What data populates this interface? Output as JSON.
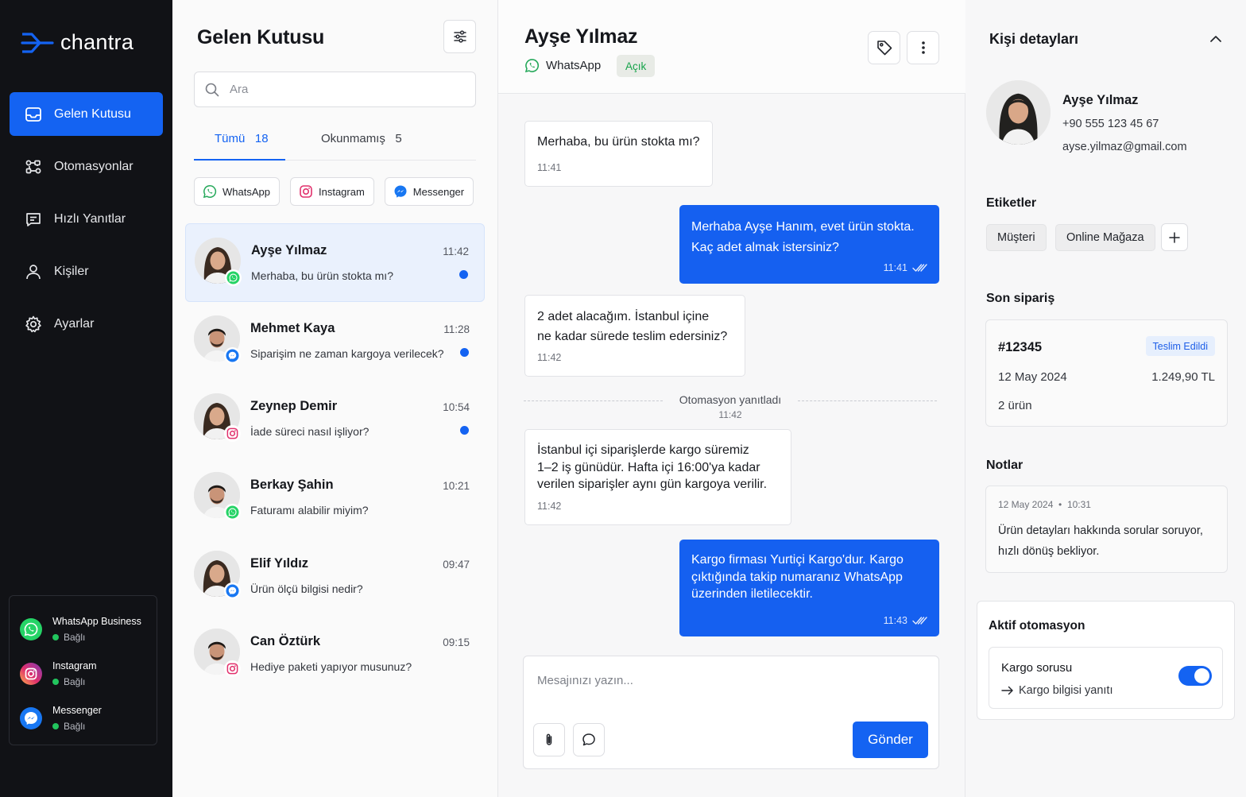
{
  "app": {
    "name": "chantra"
  },
  "colors": {
    "accent": "#1463f2",
    "sidebar_bg": "#111216",
    "online": "#22c55e",
    "open_status": "#16a34a"
  },
  "sidebar": {
    "nav": [
      {
        "label": "Gelen Kutusu",
        "icon": "inbox-icon",
        "active": true
      },
      {
        "label": "Otomasyonlar",
        "icon": "workflow-icon"
      },
      {
        "label": "Hızlı Yanıtlar",
        "icon": "quick-reply-icon"
      },
      {
        "label": "Kişiler",
        "icon": "user-icon"
      },
      {
        "label": "Ayarlar",
        "icon": "gear-icon"
      }
    ],
    "channels": [
      {
        "name": "WhatsApp Business",
        "status": "Bağlı",
        "icon": "whatsapp-icon"
      },
      {
        "name": "Instagram",
        "status": "Bağlı",
        "icon": "instagram-icon"
      },
      {
        "name": "Messenger",
        "status": "Bağlı",
        "icon": "messenger-icon"
      }
    ]
  },
  "inbox": {
    "title": "Gelen Kutusu",
    "search_placeholder": "Ara",
    "tabs": [
      {
        "label": "Tümü",
        "count": "18",
        "active": true
      },
      {
        "label": "Okunmamış",
        "count": "5"
      }
    ],
    "channel_filters": [
      {
        "label": "WhatsApp",
        "icon": "whatsapp-icon"
      },
      {
        "label": "Instagram",
        "icon": "instagram-icon"
      },
      {
        "label": "Messenger",
        "icon": "messenger-icon"
      }
    ],
    "conversations": [
      {
        "name": "Ayşe Yılmaz",
        "time": "11:42",
        "message": "Merhaba, bu ürün stokta mı?",
        "channel": "whatsapp",
        "unread": true,
        "active": true,
        "gender": "f"
      },
      {
        "name": "Mehmet Kaya",
        "time": "11:28",
        "message": "Siparişim ne zaman kargoya verilecek?",
        "channel": "messenger",
        "unread": true,
        "gender": "m"
      },
      {
        "name": "Zeynep Demir",
        "time": "10:54",
        "message": "İade süreci nasıl işliyor?",
        "channel": "instagram",
        "unread": true,
        "gender": "f"
      },
      {
        "name": "Berkay Şahin",
        "time": "10:21",
        "message": "Faturamı alabilir miyim?",
        "channel": "whatsapp",
        "unread": false,
        "gender": "m"
      },
      {
        "name": "Elif Yıldız",
        "time": "09:47",
        "message": "Ürün ölçü bilgisi nedir?",
        "channel": "messenger",
        "unread": false,
        "gender": "f"
      },
      {
        "name": "Can Öztürk",
        "time": "09:15",
        "message": "Hediye paketi yapıyor musunuz?",
        "channel": "instagram",
        "unread": false,
        "gender": "m"
      }
    ]
  },
  "chat": {
    "contact_name": "Ayşe Yılmaz",
    "channel": "WhatsApp",
    "status": "Açık",
    "messages": [
      {
        "text": "Merhaba, bu ürün stokta mı?",
        "time": "11:41",
        "dir": "in"
      },
      {
        "text": "Merhaba Ayşe Hanım, evet ürün stokta.\nKaç adet almak istersiniz?",
        "time": "11:41",
        "dir": "out"
      },
      {
        "text": "2 adet alacağım. İstanbul içine\nne kadar sürede teslim edersiniz?",
        "time": "11:42",
        "dir": "in"
      },
      {
        "text": "İstanbul içi siparişlerde kargo süremiz\n1–2 iş günüdür. Hafta içi 16:00'ya kadar\nverilen siparişler aynı gün kargoya verilir.",
        "time": "11:42",
        "dir": "in"
      },
      {
        "text": "Kargo firması Yurtiçi Kargo'dur. Kargo\nçıktığında takip numaranız WhatsApp\nüzerinden iletilecektir.",
        "time": "11:43",
        "dir": "out"
      }
    ],
    "automation_separator": {
      "label": "Otomasyon yanıtladı",
      "time": "11:42"
    },
    "composer_placeholder": "Mesajınızı yazın...",
    "send_label": "Gönder"
  },
  "details": {
    "title": "Kişi detayları",
    "contact": {
      "name": "Ayşe Yılmaz",
      "phone": "+90 555 123 45 67",
      "email": "ayse.yilmaz@gmail.com"
    },
    "tags_title": "Etiketler",
    "tags": [
      "Müşteri",
      "Online Mağaza"
    ],
    "last_order_title": "Son sipariş",
    "order": {
      "id": "#12345",
      "status": "Teslim Edildi",
      "date": "12 May 2024",
      "amount": "1.249,90 TL",
      "items": "2 ürün"
    },
    "notes_title": "Notlar",
    "note": {
      "date": "12 May 2024",
      "time": "10:31",
      "text": "Ürün detayları hakkında sorular soruyor, hızlı dönüş bekliyor."
    },
    "automation_title": "Aktif otomasyon",
    "automation": {
      "name": "Kargo sorusu",
      "action": "Kargo bilgisi yanıtı",
      "enabled": true
    }
  }
}
